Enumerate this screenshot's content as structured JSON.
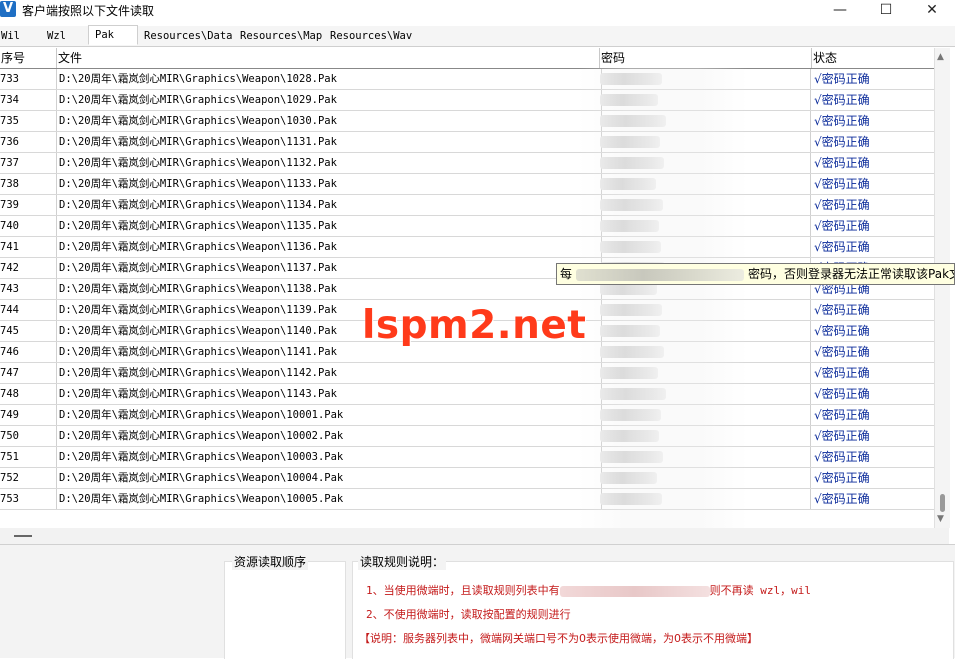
{
  "window": {
    "title": "客户端按照以下文件读取",
    "app_icon": "V",
    "controls": {
      "minimize": "—",
      "maximize": "☐",
      "close": "✕"
    }
  },
  "tabs": [
    {
      "label": "Wil"
    },
    {
      "label": "Wzl"
    },
    {
      "label": "Pak"
    },
    {
      "label": "Resources\\Data"
    },
    {
      "label": "Resources\\Map"
    },
    {
      "label": "Resources\\Wav"
    }
  ],
  "active_tab": "Pak",
  "table": {
    "columns": [
      "序号",
      "文件",
      "密码",
      "状态"
    ],
    "rows": [
      {
        "idx": "733",
        "file": "D:\\20周年\\霜岚剑心MIR\\Graphics\\Weapon\\1028.Pak",
        "status": "√密码正确"
      },
      {
        "idx": "734",
        "file": "D:\\20周年\\霜岚剑心MIR\\Graphics\\Weapon\\1029.Pak",
        "status": "√密码正确"
      },
      {
        "idx": "735",
        "file": "D:\\20周年\\霜岚剑心MIR\\Graphics\\Weapon\\1030.Pak",
        "status": "√密码正确"
      },
      {
        "idx": "736",
        "file": "D:\\20周年\\霜岚剑心MIR\\Graphics\\Weapon\\1131.Pak",
        "status": "√密码正确"
      },
      {
        "idx": "737",
        "file": "D:\\20周年\\霜岚剑心MIR\\Graphics\\Weapon\\1132.Pak",
        "status": "√密码正确"
      },
      {
        "idx": "738",
        "file": "D:\\20周年\\霜岚剑心MIR\\Graphics\\Weapon\\1133.Pak",
        "status": "√密码正确"
      },
      {
        "idx": "739",
        "file": "D:\\20周年\\霜岚剑心MIR\\Graphics\\Weapon\\1134.Pak",
        "status": "√密码正确"
      },
      {
        "idx": "740",
        "file": "D:\\20周年\\霜岚剑心MIR\\Graphics\\Weapon\\1135.Pak",
        "status": "√密码正确"
      },
      {
        "idx": "741",
        "file": "D:\\20周年\\霜岚剑心MIR\\Graphics\\Weapon\\1136.Pak",
        "status": "√密码正确"
      },
      {
        "idx": "742",
        "file": "D:\\20周年\\霜岚剑心MIR\\Graphics\\Weapon\\1137.Pak",
        "status": "√密码正确"
      },
      {
        "idx": "743",
        "file": "D:\\20周年\\霜岚剑心MIR\\Graphics\\Weapon\\1138.Pak",
        "status": "√密码正确"
      },
      {
        "idx": "744",
        "file": "D:\\20周年\\霜岚剑心MIR\\Graphics\\Weapon\\1139.Pak",
        "status": "√密码正确"
      },
      {
        "idx": "745",
        "file": "D:\\20周年\\霜岚剑心MIR\\Graphics\\Weapon\\1140.Pak",
        "status": "√密码正确"
      },
      {
        "idx": "746",
        "file": "D:\\20周年\\霜岚剑心MIR\\Graphics\\Weapon\\1141.Pak",
        "status": "√密码正确"
      },
      {
        "idx": "747",
        "file": "D:\\20周年\\霜岚剑心MIR\\Graphics\\Weapon\\1142.Pak",
        "status": "√密码正确"
      },
      {
        "idx": "748",
        "file": "D:\\20周年\\霜岚剑心MIR\\Graphics\\Weapon\\1143.Pak",
        "status": "√密码正确"
      },
      {
        "idx": "749",
        "file": "D:\\20周年\\霜岚剑心MIR\\Graphics\\Weapon\\10001.Pak",
        "status": "√密码正确"
      },
      {
        "idx": "750",
        "file": "D:\\20周年\\霜岚剑心MIR\\Graphics\\Weapon\\10002.Pak",
        "status": "√密码正确"
      },
      {
        "idx": "751",
        "file": "D:\\20周年\\霜岚剑心MIR\\Graphics\\Weapon\\10003.Pak",
        "status": "√密码正确"
      },
      {
        "idx": "752",
        "file": "D:\\20周年\\霜岚剑心MIR\\Graphics\\Weapon\\10004.Pak",
        "status": "√密码正确"
      },
      {
        "idx": "753",
        "file": "D:\\20周年\\霜岚剑心MIR\\Graphics\\Weapon\\10005.Pak",
        "status": "√密码正确"
      }
    ]
  },
  "tooltip": {
    "prefix": "每",
    "suffix": "密码，否则登录器无法正常读取该Pak文"
  },
  "watermark": "lspm2.net",
  "bottom": {
    "resource_order_title": "资源读取顺序",
    "rules_title": "读取规则说明：",
    "rule1_start": "1、当使用微端时，且读取规则列表中有",
    "rule1_end": "则不再读 wzl，wil",
    "rule2": "2、不使用微端时，读取按配置的规则进行",
    "note": "【说明：服务器列表中，微端网关端口号不为0表示使用微端，为0表示不用微端】"
  },
  "colors": {
    "status_text": "#0a2a9a",
    "rule_text": "#c41a1a",
    "tooltip_bg": "#ffffe1",
    "watermark": "#ff3a1a"
  }
}
